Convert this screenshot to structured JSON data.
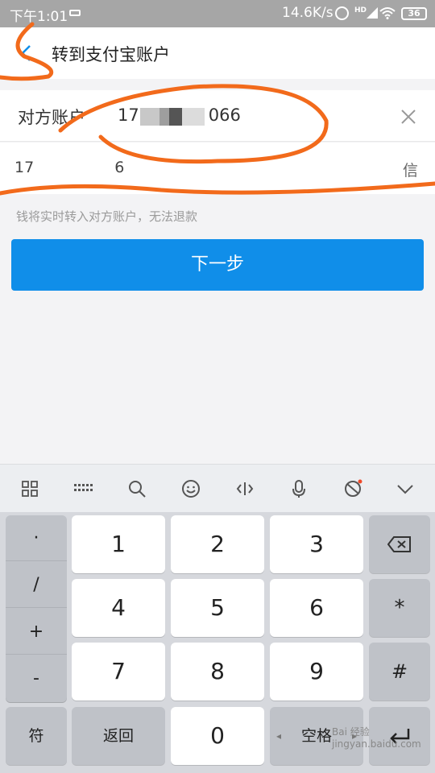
{
  "status_bar": {
    "time": "下午1:01",
    "net_speed": "14.6K/s",
    "signal": "HD",
    "battery": "36"
  },
  "nav": {
    "title": "转到支付宝账户"
  },
  "form": {
    "account_label": "对方账户",
    "account_prefix": "17",
    "account_suffix": "066",
    "name_prefix": "17",
    "name_suffix": "6",
    "name_tag": "信",
    "hint": "钱将实时转入对方账户，无法退款"
  },
  "next_button": "下一步",
  "keyboard": {
    "symbols": [
      "·",
      "/",
      "+",
      "-"
    ],
    "digits": [
      "1",
      "2",
      "3",
      "4",
      "5",
      "6",
      "7",
      "8",
      "9",
      "0"
    ],
    "star": "*",
    "hash": "#",
    "fu": "符",
    "back": "返回",
    "space": "空格"
  },
  "watermark": "Bai 经验 jingyan.baidu.com",
  "colors": {
    "accent": "#108ee9",
    "scribble": "#f26a1b"
  }
}
